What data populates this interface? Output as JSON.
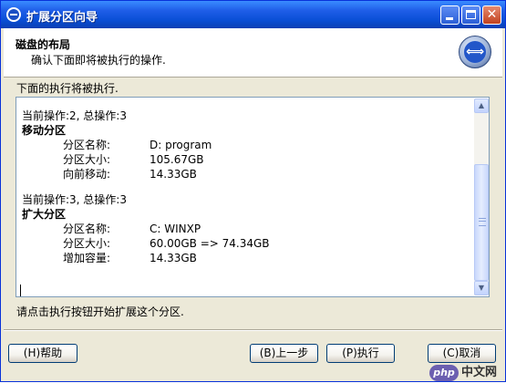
{
  "window": {
    "title": "扩展分区向导",
    "colors": {
      "titlebar": "#0a4fd6",
      "face": "#ece9d8",
      "close": "#c1421f"
    }
  },
  "titlebar_icons": [
    "app-icon",
    "minimize-icon",
    "maximize-icon",
    "close-icon"
  ],
  "header": {
    "title": "磁盘的布局",
    "subtitle": "确认下面即将被执行的操作.",
    "icon": "disk-expand-icon"
  },
  "intro": "下面的执行将被执行.",
  "operations": [
    {
      "counter": "当前操作:2, 总操作:3",
      "name": "移动分区",
      "fields": [
        {
          "label": "分区名称:",
          "value": "D: program"
        },
        {
          "label": "分区大小:",
          "value": "105.67GB"
        },
        {
          "label": "向前移动:",
          "value": "14.33GB"
        }
      ]
    },
    {
      "counter": "当前操作:3, 总操作:3",
      "name": "扩大分区",
      "fields": [
        {
          "label": "分区名称:",
          "value": "C: WINXP"
        },
        {
          "label": "分区大小:",
          "value": "60.00GB => 74.34GB"
        },
        {
          "label": "增加容量:",
          "value": "14.33GB"
        }
      ]
    }
  ],
  "scrollbar": {
    "up_glyph": "▲",
    "down_glyph": "▼",
    "position": 0.6
  },
  "hint": "请点击执行按钮开始扩展这个分区.",
  "buttons": {
    "help": "(H)帮助",
    "back": "(B)上一步",
    "execute": "(P)执行",
    "cancel": "(C)取消"
  },
  "watermark": {
    "badge": "php",
    "text": "中文网"
  }
}
